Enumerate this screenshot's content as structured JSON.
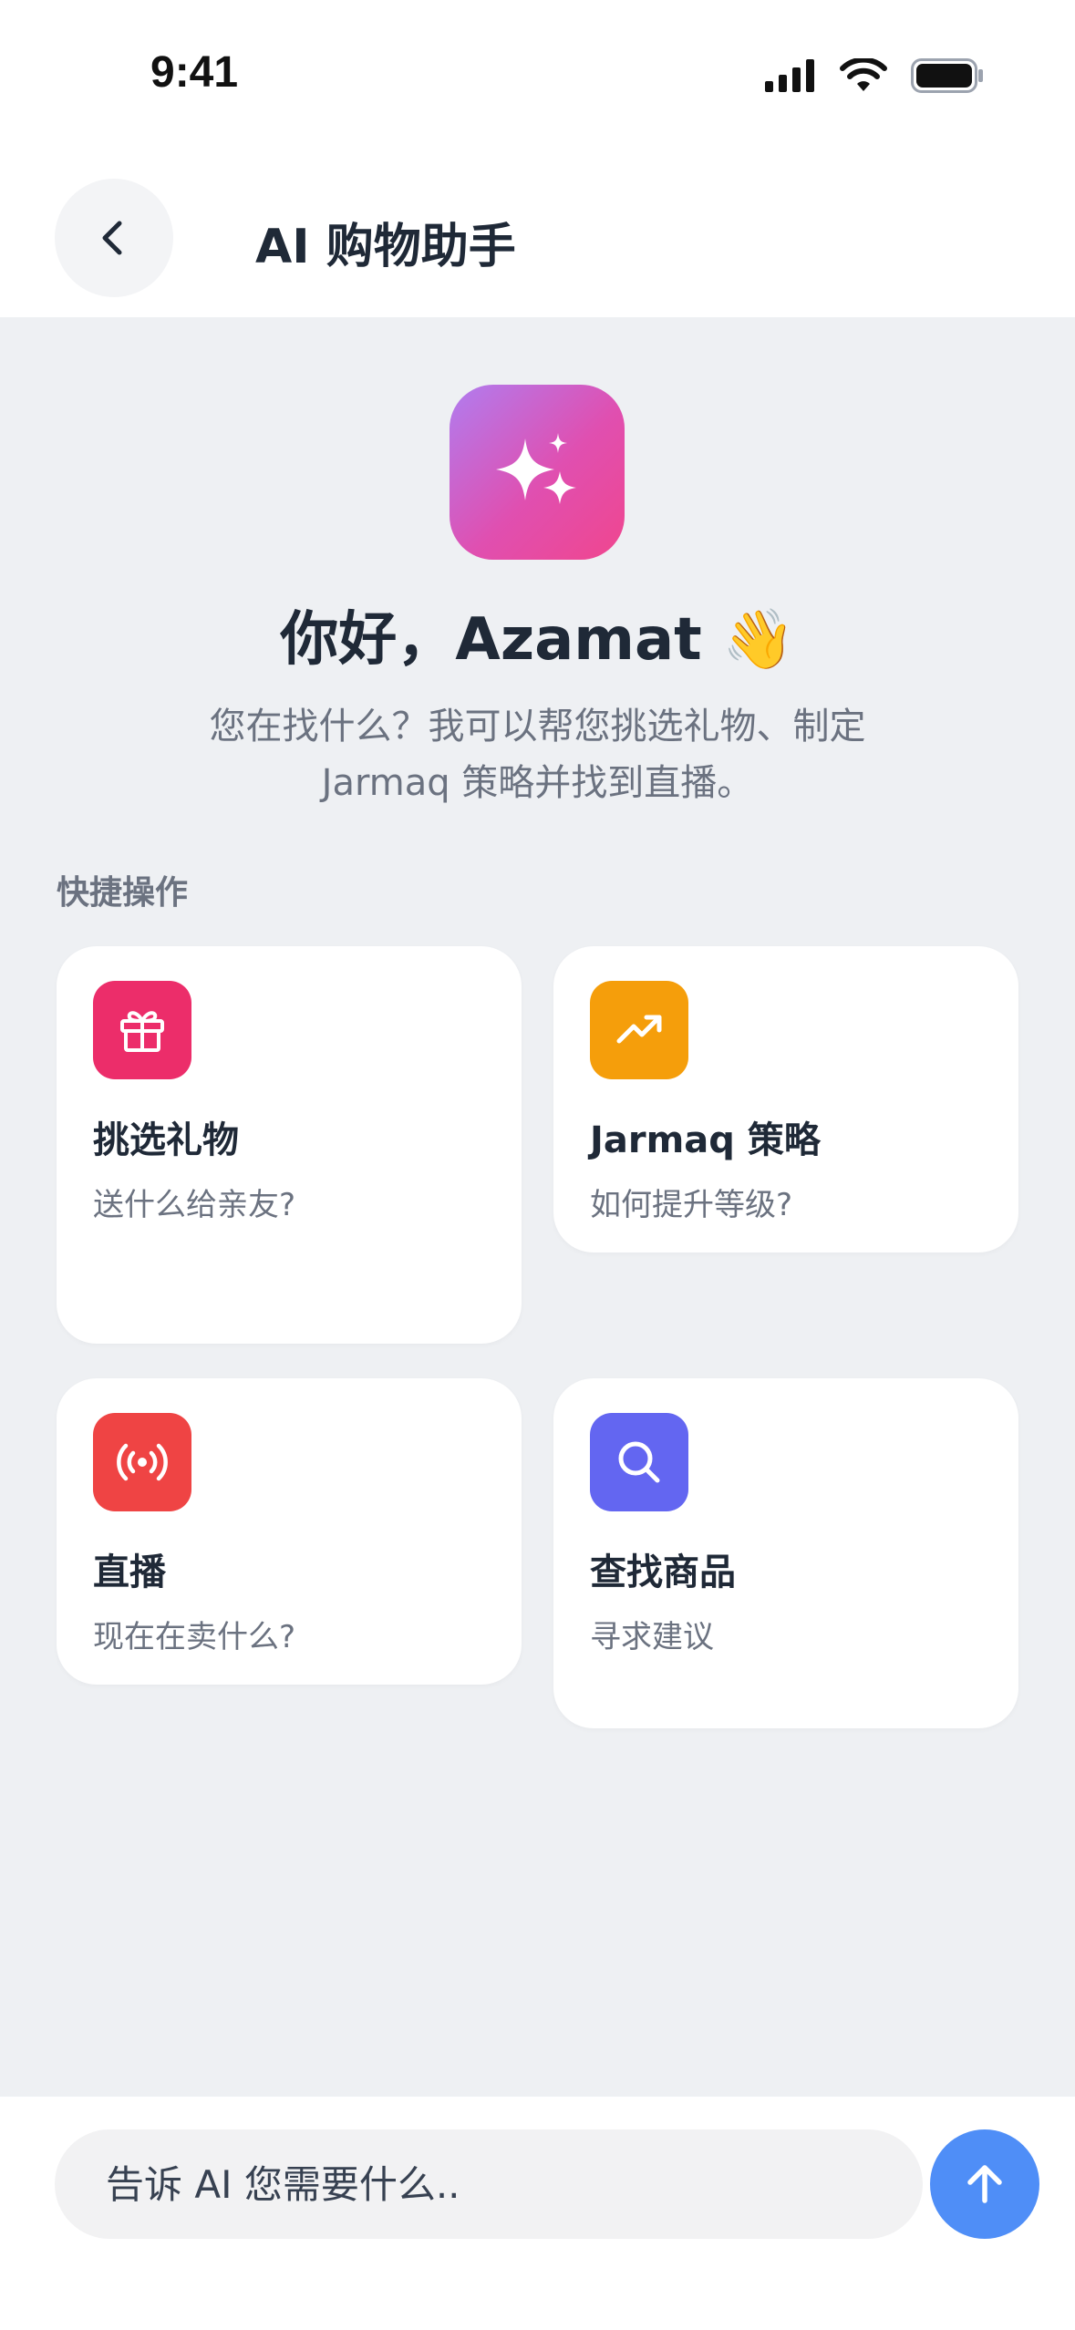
{
  "status_bar": {
    "time": "9:41"
  },
  "header": {
    "title": "AI 购物助手",
    "back_icon": "chevron-left-icon"
  },
  "hero": {
    "icon": "sparkles-icon",
    "icon_gradient": [
      "#b07df0",
      "#f0468e"
    ],
    "greeting": "你好，Azamat",
    "greeting_emoji": "👋",
    "subtitle_line1": "您在找什么？我可以帮您挑选礼物、制定",
    "subtitle_line2": "Jarmaq 策略并找到直播。"
  },
  "quick_actions": {
    "label": "快捷操作",
    "cards": [
      {
        "title": "挑选礼物",
        "subtitle": "送什么给亲友?",
        "icon": "gift-icon",
        "color": "#ec2d6a"
      },
      {
        "title": "Jarmaq 策略",
        "subtitle": "如何提升等级?",
        "icon": "trending-up-icon",
        "color": "#f59e0b"
      },
      {
        "title": "直播",
        "subtitle": "现在在卖什么?",
        "icon": "broadcast-icon",
        "color": "#ef4444"
      },
      {
        "title": "查找商品",
        "subtitle": "寻求建议",
        "icon": "search-icon",
        "color": "#6366f1"
      }
    ]
  },
  "composer": {
    "placeholder": "告诉 AI 您需要什么..",
    "send_icon": "arrow-up-icon",
    "send_color": "#4f8ef7"
  }
}
